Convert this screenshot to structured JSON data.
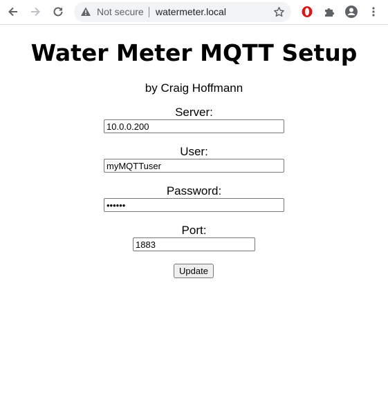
{
  "browser": {
    "security_label": "Not secure",
    "url": "watermeter.local",
    "icons": [
      "back-arrow-icon",
      "forward-arrow-icon",
      "reload-icon",
      "warning-icon",
      "star-icon",
      "opera-extension-icon",
      "puzzle-icon",
      "profile-icon",
      "kebab-menu-icon"
    ]
  },
  "page": {
    "title": "Water Meter MQTT Setup",
    "byline": "by Craig Hoffmann"
  },
  "form": {
    "server": {
      "label": "Server:",
      "value": "10.0.0.200"
    },
    "user": {
      "label": "User:",
      "value": "myMQTTuser"
    },
    "password": {
      "label": "Password:",
      "value": "••••••"
    },
    "port": {
      "label": "Port:",
      "value": "1883"
    },
    "submit_label": "Update"
  }
}
